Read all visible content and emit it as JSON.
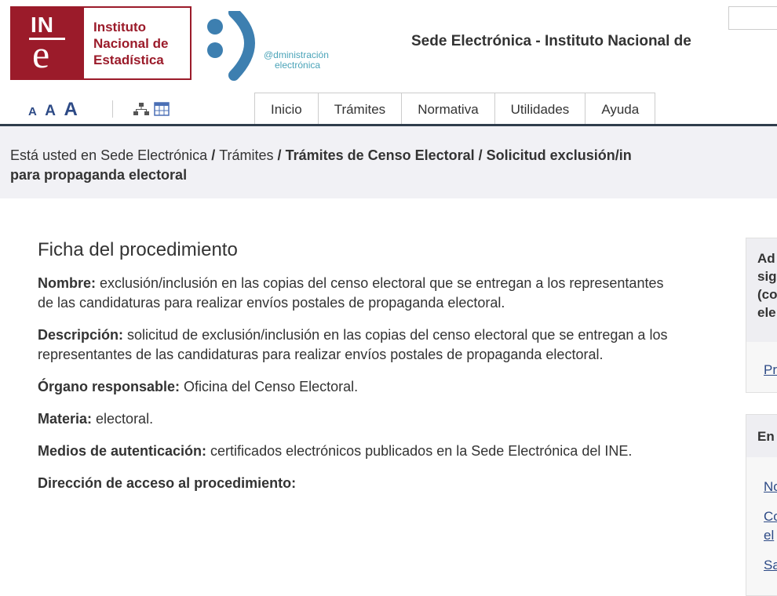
{
  "header": {
    "logo_text_1": "Instituto",
    "logo_text_2": "Nacional de",
    "logo_text_3": "Estadística",
    "logo_mark_top": "IN",
    "logo_mark_bottom": "e",
    "adm_text_1": "@dministración",
    "adm_text_2": "electrónica",
    "title": "Sede Electrónica - Instituto Nacional de"
  },
  "toolbar": {
    "font_small": "A",
    "font_medium": "A",
    "font_large": "A"
  },
  "nav": {
    "items": [
      "Inicio",
      "Trámites",
      "Normativa",
      "Utilidades",
      "Ayuda"
    ]
  },
  "breadcrumb": {
    "prefix": "Está usted en",
    "home": "Sede Electrónica",
    "sep": " / ",
    "level1": "Trámites",
    "level2": "Trámites de Censo Electoral",
    "level3_line1": "Solicitud exclusión/in",
    "level3_line2": "para propaganda electoral"
  },
  "main": {
    "title": "Ficha del procedimiento",
    "nombre_label": "Nombre:",
    "nombre_value": " exclusión/inclusión en las copias del censo electoral que se entregan a los representantes de las candidaturas para realizar envíos postales de propaganda electoral.",
    "descripcion_label": "Descripción:",
    "descripcion_value": " solicitud de exclusión/inclusión en las copias del censo electoral que se entregan a los representantes de las candidaturas para realizar envíos postales de propaganda electoral.",
    "organo_label": "Órgano responsable:",
    "organo_value": " Oficina del Censo Electoral.",
    "materia_label": "Materia:",
    "materia_value": " electoral.",
    "medios_label": "Medios de autenticación:",
    "medios_value": " certificados electrónicos publicados en la Sede Electrónica del INE.",
    "direccion_label": "Dirección de acceso al procedimiento:"
  },
  "side1": {
    "heading": "Ad\nsig\n(co\nele",
    "link": "Pr"
  },
  "side2": {
    "heading": "En",
    "links": [
      "No",
      "Co",
      "el",
      "Sa"
    ]
  }
}
